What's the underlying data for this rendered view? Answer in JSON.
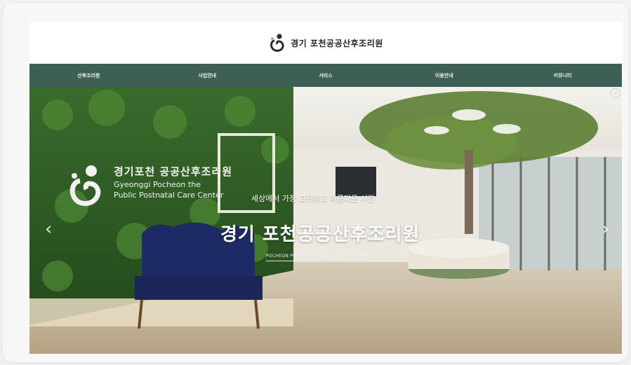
{
  "header": {
    "logo_text": "경기 포천공공산후조리원"
  },
  "nav": {
    "items": [
      "산후조리원",
      "사업안내",
      "서비스",
      "이용안내",
      "커뮤니티"
    ]
  },
  "hero": {
    "wall_sign_ko": "경기포천 공공산후조리원",
    "wall_sign_en_1": "Gyeonggi Pocheon the",
    "wall_sign_en_2": "Public Postnatal Care Center",
    "subtitle": "세상에서 가장 고귀하고 아름다운 시간",
    "title": "경기 포천공공산후조리원",
    "english": "POCHEON PUBLIC POSTNATAL CARE CENTER",
    "prev_icon": "chevron-left-icon",
    "next_icon": "chevron-right-icon",
    "close_icon": "close-icon"
  },
  "colors": {
    "nav_bg": "#3d5f55",
    "accent_green": "#3e6b3a"
  }
}
